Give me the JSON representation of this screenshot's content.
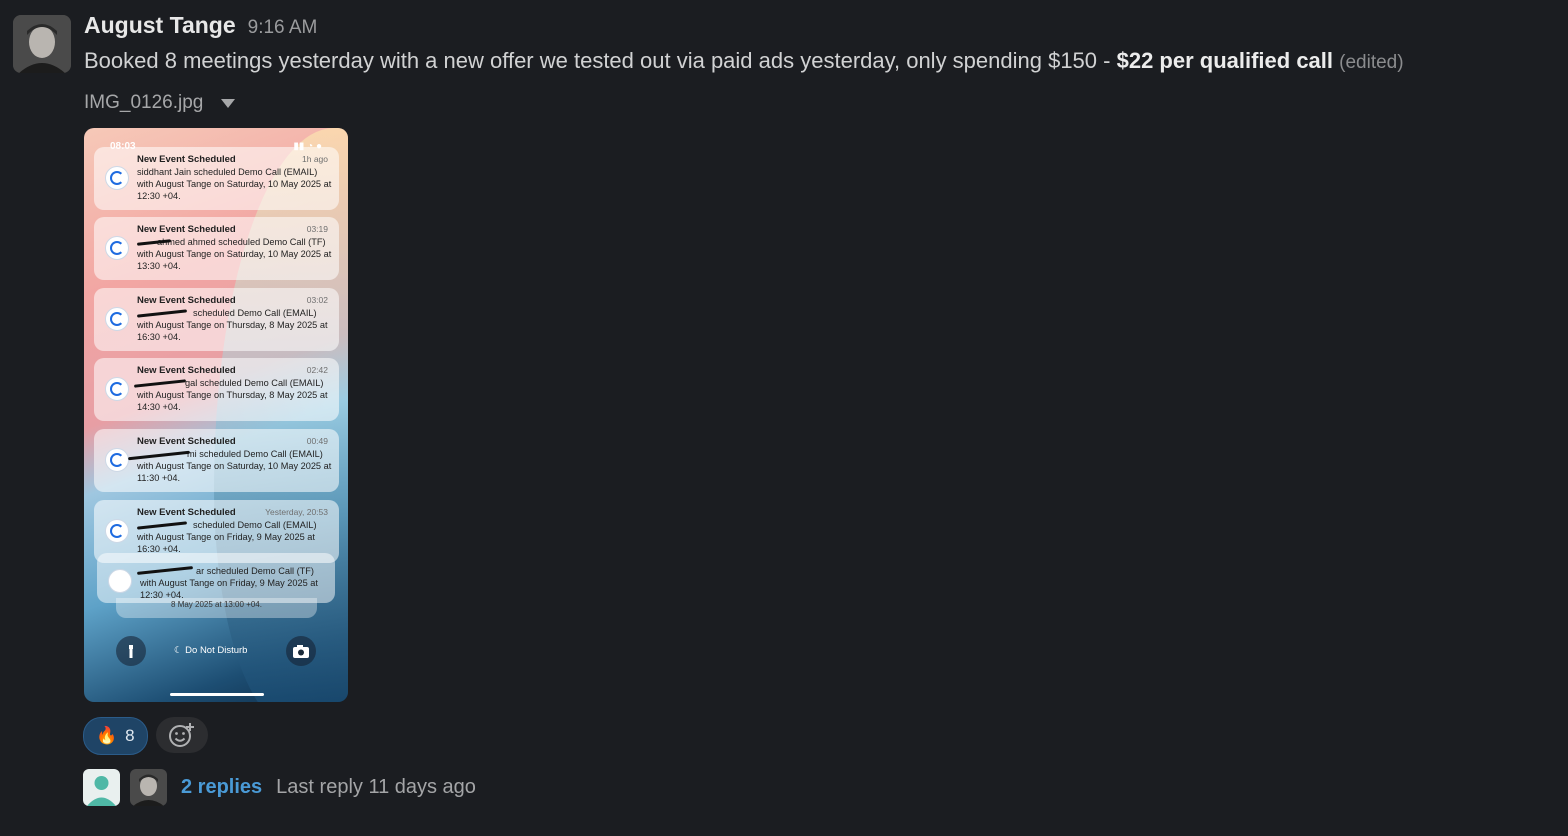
{
  "message": {
    "author": "August Tange",
    "time": "9:16 AM",
    "text_main": "Booked 8 meetings yesterday with a new offer we tested out via paid ads yesterday, only spending $150 - ",
    "text_bold": "$22 per qualified call",
    "edited": "(edited)"
  },
  "attachment": {
    "filename": "IMG_0126.jpg",
    "status_time": "08:03",
    "notifications": [
      {
        "title": "New Event Scheduled",
        "time": "1h ago",
        "body": "siddhant Jain scheduled Demo Call (EMAIL) with August Tange on Saturday, 10 May 2025 at 12:30 +04."
      },
      {
        "title": "New Event Scheduled",
        "time": "03:19",
        "body": "ahmed ahmed scheduled Demo Call (TF)  with August Tange on Saturday, 10 May 2025 at 13:30 +04."
      },
      {
        "title": "New Event Scheduled",
        "time": "03:02",
        "body": "scheduled Demo Call (EMAIL) with August Tange on Thursday, 8 May 2025 at 16:30 +04."
      },
      {
        "title": "New Event Scheduled",
        "time": "02:42",
        "body": "gal scheduled Demo Call (EMAIL) with August Tange on Thursday, 8 May 2025 at 14:30 +04."
      },
      {
        "title": "New Event Scheduled",
        "time": "00:49",
        "body": "mi scheduled Demo Call (EMAIL) with August Tange on Saturday, 10 May 2025 at 11:30 +04."
      },
      {
        "title": "New Event Scheduled",
        "time": "Yesterday, 20:53",
        "body": "scheduled Demo Call (EMAIL) with August Tange on Friday, 9 May 2025 at 16:30 +04."
      }
    ],
    "stack_body": "ar scheduled Demo Call (TF)  with August Tange on Friday, 9 May 2025 at 12:30 +04.",
    "stack_tail": "8 May 2025 at 13:00 +04.",
    "dnd_label": "Do Not Disturb"
  },
  "reactions": [
    {
      "emoji": "🔥",
      "count": "8"
    }
  ],
  "thread": {
    "replies": "2 replies",
    "last_reply": "Last reply 11 days ago"
  }
}
